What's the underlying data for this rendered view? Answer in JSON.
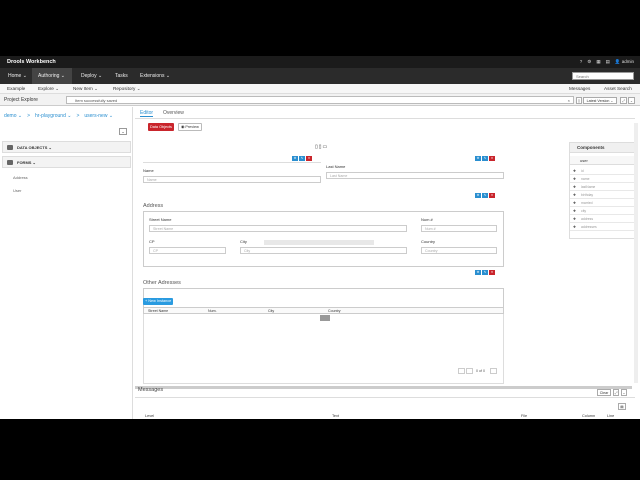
{
  "app": {
    "brand": "Drools Workbench",
    "user": "admin"
  },
  "menubar": {
    "items": [
      {
        "label": "Home ⌄"
      },
      {
        "label": "Authoring ⌄"
      },
      {
        "label": "Deploy ⌄"
      },
      {
        "label": "Tasks"
      },
      {
        "label": "Extensions ⌄"
      }
    ],
    "search_placeholder": "Search"
  },
  "subbar": {
    "left": [
      "Example",
      "Explore ⌄",
      "New Item ⌄",
      "Repository ⌄"
    ],
    "right": [
      "Messages",
      "Asset Search"
    ]
  },
  "toolbar": {
    "project_explorer": "Project Explore",
    "notice": "Item successfully saved",
    "latest_version": "Latest Version ⌄"
  },
  "left": {
    "breadcrumbs": [
      "demo ⌄",
      ">",
      "hr-playground ⌄",
      ">",
      "users-new ⌄"
    ],
    "sections": [
      "DATA OBJECTS ⌄",
      "FORMS ⌄"
    ],
    "form_items": [
      "Address",
      "User"
    ]
  },
  "center": {
    "tabs": [
      "Editor",
      "Overview"
    ],
    "data_objects_btn": "Data Objects",
    "preview_btn": "Preview",
    "devices": "▯▯▭",
    "name_label": "Name",
    "name_placeholder": "Name",
    "lastname_label": "Last Name",
    "lastname_placeholder": "Last Name",
    "address_title": "Address",
    "street_label": "Street Name",
    "street_placeholder": "Street Name",
    "num_label": "Num #",
    "num_placeholder": "Num #",
    "cp_label": "CP",
    "cp_placeholder": "CP",
    "city_label": "City",
    "city_placeholder": "City",
    "country_label": "Country",
    "country_placeholder": "Country",
    "other_title": "Other Adresses",
    "new_instance": "+ New Instance",
    "grid_cols": [
      "Street Name",
      "Num.",
      "City",
      "Country"
    ],
    "pager": "0 of 0"
  },
  "components": {
    "title": "Components",
    "entity": "user",
    "fields": [
      "id",
      "name",
      "lastName",
      "birthday",
      "married",
      "city",
      "address",
      "addresses"
    ]
  },
  "messages": {
    "title": "Messages",
    "clear": "Clear",
    "cols": [
      "Level",
      "Text",
      "File",
      "Column",
      "Line"
    ]
  }
}
